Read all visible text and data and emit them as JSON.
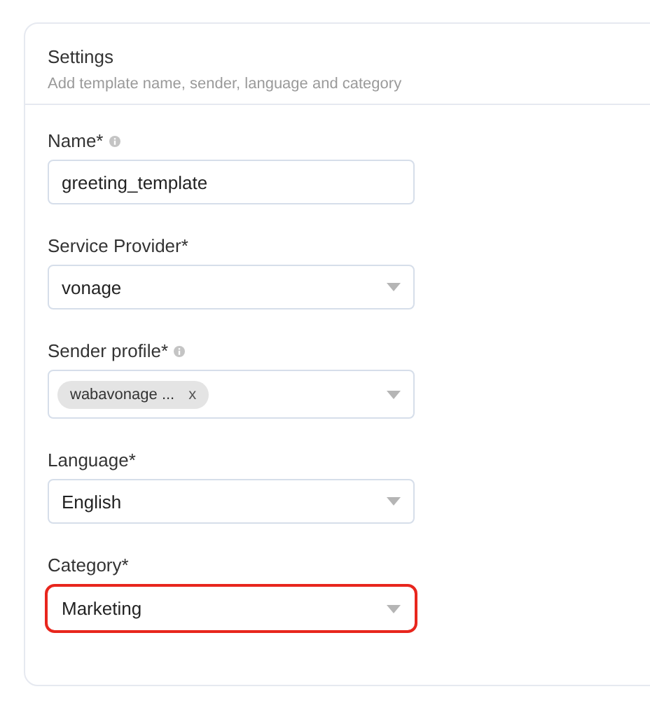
{
  "panel": {
    "title": "Settings",
    "subtitle": "Add template name, sender, language and category"
  },
  "fields": [
    {
      "kind": "text",
      "label": "Name*",
      "info": true,
      "value": "greeting_template",
      "highlighted": false
    },
    {
      "kind": "select",
      "label": "Service Provider*",
      "info": false,
      "value": "vonage",
      "highlighted": false
    },
    {
      "kind": "tags",
      "label": "Sender profile*",
      "info": true,
      "tags": [
        "wabavonage ..."
      ],
      "tag_remove": "x",
      "highlighted": false
    },
    {
      "kind": "select",
      "label": "Language*",
      "info": false,
      "value": "English",
      "highlighted": false
    },
    {
      "kind": "select",
      "label": "Category*",
      "info": false,
      "value": "Marketing",
      "highlighted": true
    }
  ]
}
